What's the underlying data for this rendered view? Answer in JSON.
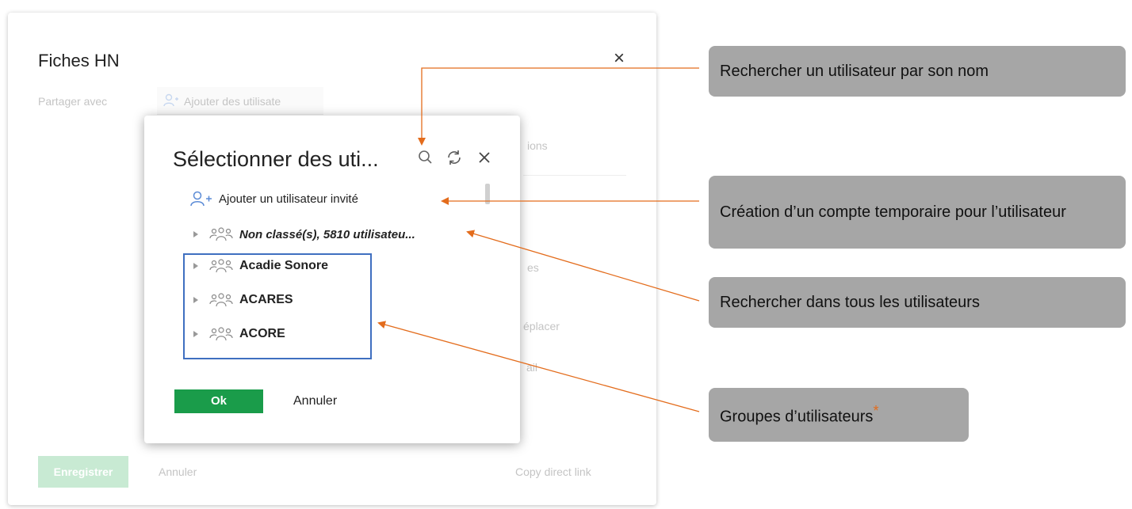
{
  "outer_dialog": {
    "title": "Fiches HN",
    "close_glyph": "×",
    "share_label": "Partager avec",
    "share_input_text": "Ajouter des utilisate",
    "options_fragment": "ions",
    "options_fragment2": "es",
    "move_fragment": "éplacer",
    "mail_fragment": "ail",
    "save_label": "Enregistrer",
    "cancel_label": "Annuler",
    "copy_link_label": "Copy direct link"
  },
  "picker": {
    "title": "Sélectionner des uti...",
    "close_glyph": "×",
    "invite_label": "Ajouter un utilisateur invité",
    "unsorted_label": "Non classé(s), 5810 utilisateu...",
    "groups": [
      {
        "label": "Acadie Sonore"
      },
      {
        "label": "ACARES"
      },
      {
        "label": "ACORE"
      }
    ],
    "ok_label": "Ok",
    "cancel_label": "Annuler"
  },
  "callouts": {
    "search": "Rechercher un utilisateur par son nom",
    "temp_account": "Création d’un compte temporaire pour l’utilisateur",
    "search_all": "Rechercher dans tous les utilisateurs",
    "groups": "Groupes d’utilisateurs",
    "groups_star": "*"
  },
  "colors": {
    "accent_green": "#1a9c4a",
    "arrow_orange": "#e36c1c",
    "callout_gray": "#a6a6a6",
    "highlight_blue": "#3f6fc0"
  },
  "icons": [
    "close-icon",
    "add-user-icon",
    "search-icon",
    "refresh-icon",
    "expand-triangle-icon",
    "user-group-icon"
  ]
}
